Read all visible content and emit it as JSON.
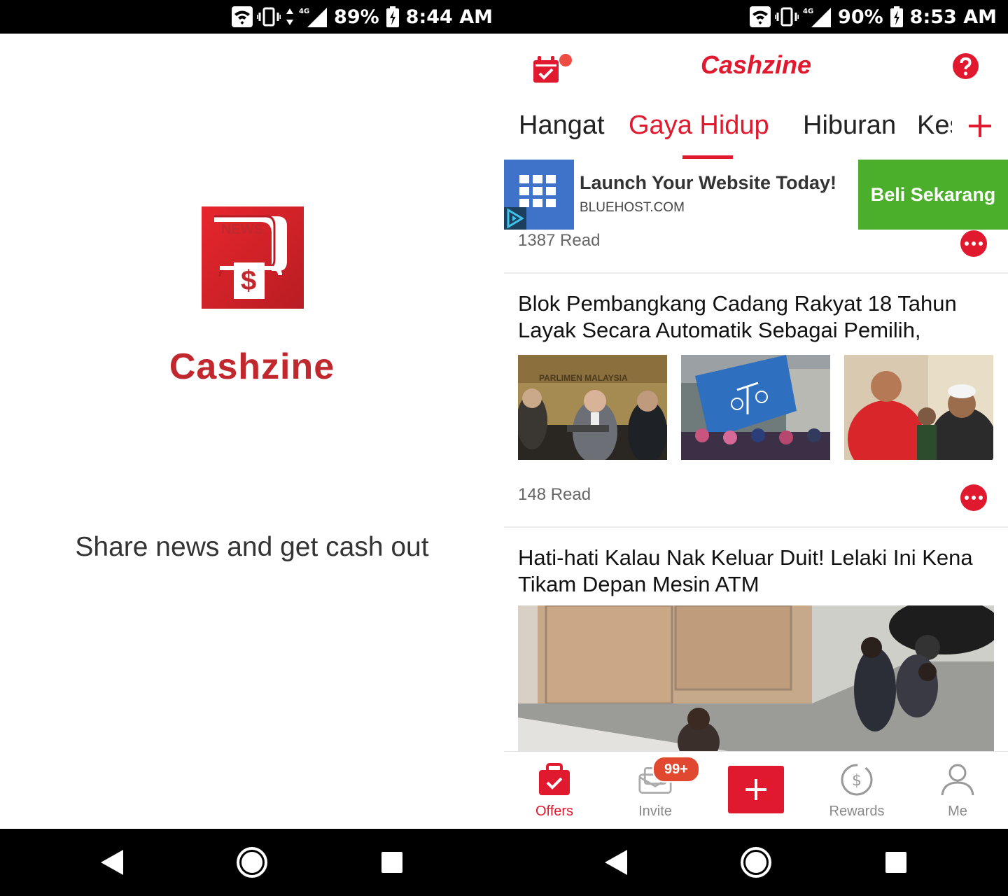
{
  "left_screen": {
    "status": {
      "battery": "89%",
      "time": "8:44 AM",
      "network": "4G"
    },
    "logo": {
      "label": "NEWS",
      "symbol": "$"
    },
    "brand": "Cashzine",
    "tagline": "Share news and get cash out"
  },
  "right_screen": {
    "status": {
      "battery": "90%",
      "time": "8:53 AM",
      "network": "4G"
    },
    "header": {
      "brand": "Cashzine",
      "icons": [
        "calendar-check-icon",
        "help-icon"
      ]
    },
    "tabs": [
      "Hangat",
      "Gaya Hidup",
      "Hiburan",
      "Kes"
    ],
    "active_tab": "Gaya Hidup",
    "ad": {
      "title": "Launch Your Website Today!",
      "domain": "BLUEHOST.COM",
      "cta": "Beli Sekarang"
    },
    "feed": [
      {
        "reads": "1387 Read"
      },
      {
        "title": "Blok Pembangkang Cadang Rakyat 18 Tahun Layak Secara Automatik Sebagai Pemilih,",
        "reads": "148 Read",
        "image_text": "PARLIMEN MALAYSIA"
      },
      {
        "title": "Hati-hati Kalau Nak Keluar Duit! Lelaki Ini Kena Tikam Depan Mesin ATM"
      }
    ],
    "bottom_nav": {
      "offers": "Offers",
      "invite": "Invite",
      "invite_badge": "99+",
      "rewards": "Rewards",
      "me": "Me"
    }
  },
  "colors": {
    "accent": "#e0192f",
    "splash_red": "#c0282e",
    "ad_blue": "#3f72c9",
    "ad_green": "#4caf2c"
  }
}
